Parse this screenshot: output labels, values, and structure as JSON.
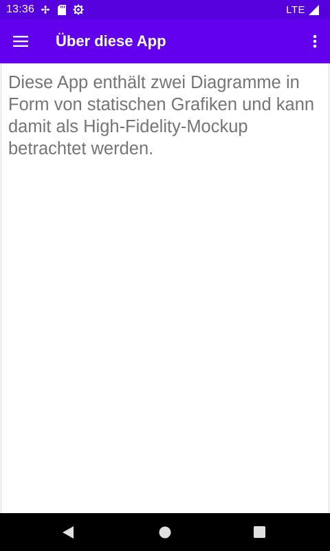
{
  "status_bar": {
    "time": "13:36",
    "network": "LTE",
    "icons": [
      "fan-icon",
      "sd-card-icon",
      "settings-gear-icon",
      "signal-icon"
    ]
  },
  "app_bar": {
    "title": "Über diese App",
    "menu_icon": "hamburger-menu-icon",
    "overflow_icon": "more-vert-icon"
  },
  "content": {
    "text": "Diese App enthält zwei Diagramme in Form von statischen Grafiken und kann damit als High-Fidelity-Mockup betrachtet werden."
  },
  "nav_bar": {
    "icons": [
      "back-icon",
      "home-icon",
      "recent-apps-icon"
    ]
  },
  "colors": {
    "status_bar": "#5500dd",
    "app_bar": "#6200ee",
    "body_text": "#757575",
    "nav_bar": "#000000"
  }
}
